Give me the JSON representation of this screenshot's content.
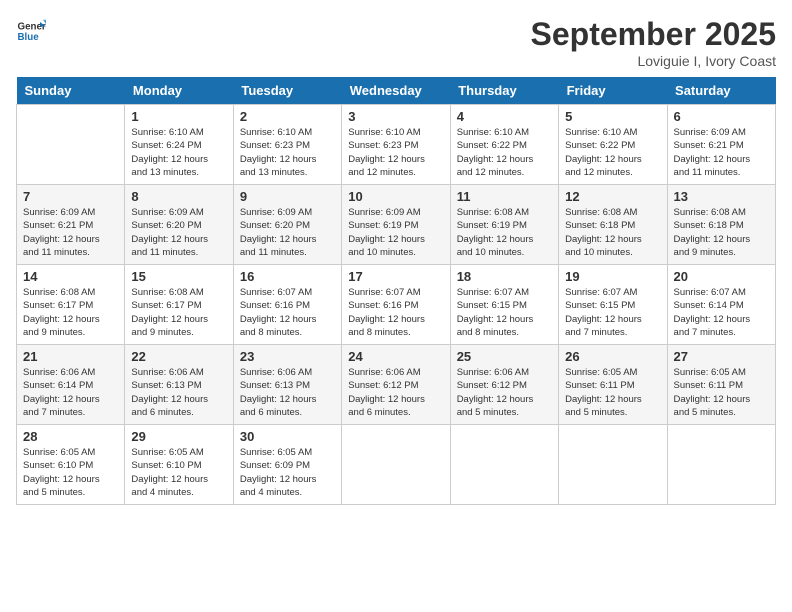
{
  "header": {
    "logo_line1": "General",
    "logo_line2": "Blue",
    "month": "September 2025",
    "location": "Loviguie I, Ivory Coast"
  },
  "weekdays": [
    "Sunday",
    "Monday",
    "Tuesday",
    "Wednesday",
    "Thursday",
    "Friday",
    "Saturday"
  ],
  "weeks": [
    [
      {
        "day": "",
        "info": ""
      },
      {
        "day": "1",
        "info": "Sunrise: 6:10 AM\nSunset: 6:24 PM\nDaylight: 12 hours\nand 13 minutes."
      },
      {
        "day": "2",
        "info": "Sunrise: 6:10 AM\nSunset: 6:23 PM\nDaylight: 12 hours\nand 13 minutes."
      },
      {
        "day": "3",
        "info": "Sunrise: 6:10 AM\nSunset: 6:23 PM\nDaylight: 12 hours\nand 12 minutes."
      },
      {
        "day": "4",
        "info": "Sunrise: 6:10 AM\nSunset: 6:22 PM\nDaylight: 12 hours\nand 12 minutes."
      },
      {
        "day": "5",
        "info": "Sunrise: 6:10 AM\nSunset: 6:22 PM\nDaylight: 12 hours\nand 12 minutes."
      },
      {
        "day": "6",
        "info": "Sunrise: 6:09 AM\nSunset: 6:21 PM\nDaylight: 12 hours\nand 11 minutes."
      }
    ],
    [
      {
        "day": "7",
        "info": "Sunrise: 6:09 AM\nSunset: 6:21 PM\nDaylight: 12 hours\nand 11 minutes."
      },
      {
        "day": "8",
        "info": "Sunrise: 6:09 AM\nSunset: 6:20 PM\nDaylight: 12 hours\nand 11 minutes."
      },
      {
        "day": "9",
        "info": "Sunrise: 6:09 AM\nSunset: 6:20 PM\nDaylight: 12 hours\nand 11 minutes."
      },
      {
        "day": "10",
        "info": "Sunrise: 6:09 AM\nSunset: 6:19 PM\nDaylight: 12 hours\nand 10 minutes."
      },
      {
        "day": "11",
        "info": "Sunrise: 6:08 AM\nSunset: 6:19 PM\nDaylight: 12 hours\nand 10 minutes."
      },
      {
        "day": "12",
        "info": "Sunrise: 6:08 AM\nSunset: 6:18 PM\nDaylight: 12 hours\nand 10 minutes."
      },
      {
        "day": "13",
        "info": "Sunrise: 6:08 AM\nSunset: 6:18 PM\nDaylight: 12 hours\nand 9 minutes."
      }
    ],
    [
      {
        "day": "14",
        "info": "Sunrise: 6:08 AM\nSunset: 6:17 PM\nDaylight: 12 hours\nand 9 minutes."
      },
      {
        "day": "15",
        "info": "Sunrise: 6:08 AM\nSunset: 6:17 PM\nDaylight: 12 hours\nand 9 minutes."
      },
      {
        "day": "16",
        "info": "Sunrise: 6:07 AM\nSunset: 6:16 PM\nDaylight: 12 hours\nand 8 minutes."
      },
      {
        "day": "17",
        "info": "Sunrise: 6:07 AM\nSunset: 6:16 PM\nDaylight: 12 hours\nand 8 minutes."
      },
      {
        "day": "18",
        "info": "Sunrise: 6:07 AM\nSunset: 6:15 PM\nDaylight: 12 hours\nand 8 minutes."
      },
      {
        "day": "19",
        "info": "Sunrise: 6:07 AM\nSunset: 6:15 PM\nDaylight: 12 hours\nand 7 minutes."
      },
      {
        "day": "20",
        "info": "Sunrise: 6:07 AM\nSunset: 6:14 PM\nDaylight: 12 hours\nand 7 minutes."
      }
    ],
    [
      {
        "day": "21",
        "info": "Sunrise: 6:06 AM\nSunset: 6:14 PM\nDaylight: 12 hours\nand 7 minutes."
      },
      {
        "day": "22",
        "info": "Sunrise: 6:06 AM\nSunset: 6:13 PM\nDaylight: 12 hours\nand 6 minutes."
      },
      {
        "day": "23",
        "info": "Sunrise: 6:06 AM\nSunset: 6:13 PM\nDaylight: 12 hours\nand 6 minutes."
      },
      {
        "day": "24",
        "info": "Sunrise: 6:06 AM\nSunset: 6:12 PM\nDaylight: 12 hours\nand 6 minutes."
      },
      {
        "day": "25",
        "info": "Sunrise: 6:06 AM\nSunset: 6:12 PM\nDaylight: 12 hours\nand 5 minutes."
      },
      {
        "day": "26",
        "info": "Sunrise: 6:05 AM\nSunset: 6:11 PM\nDaylight: 12 hours\nand 5 minutes."
      },
      {
        "day": "27",
        "info": "Sunrise: 6:05 AM\nSunset: 6:11 PM\nDaylight: 12 hours\nand 5 minutes."
      }
    ],
    [
      {
        "day": "28",
        "info": "Sunrise: 6:05 AM\nSunset: 6:10 PM\nDaylight: 12 hours\nand 5 minutes."
      },
      {
        "day": "29",
        "info": "Sunrise: 6:05 AM\nSunset: 6:10 PM\nDaylight: 12 hours\nand 4 minutes."
      },
      {
        "day": "30",
        "info": "Sunrise: 6:05 AM\nSunset: 6:09 PM\nDaylight: 12 hours\nand 4 minutes."
      },
      {
        "day": "",
        "info": ""
      },
      {
        "day": "",
        "info": ""
      },
      {
        "day": "",
        "info": ""
      },
      {
        "day": "",
        "info": ""
      }
    ]
  ]
}
